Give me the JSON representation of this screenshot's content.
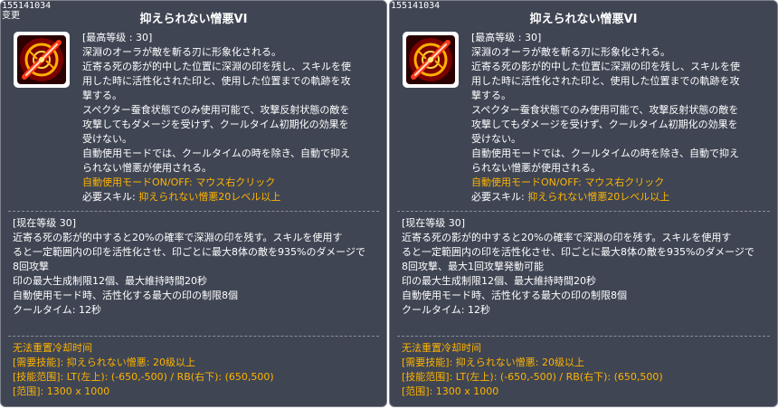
{
  "panels": [
    {
      "id_text": "155141034",
      "tag": "变更",
      "title": "抑えられない憎悪VI",
      "icon": "skill-icon",
      "desc": [
        "[最高等级 : 30]",
        "深淵のオーラが敵を斬る刃に形象化される。",
        "近寄る死の影が的中した位置に深淵の印を残し、スキルを使",
        "用した時に活性化された印と、使用した位置までの軌跡を攻",
        "撃する。",
        "スペクター蚕食状態でのみ使用可能で、攻撃反射状態の敵を",
        "攻撃してもダメージを受けず、クールタイム初期化の効果を",
        "受けない。",
        "自動使用モードでは、クールタイムの時を除き、自動で抑え",
        "られない憎悪が使用される。"
      ],
      "desc_orange": "自動使用モードON/OFF: マウス右クリック",
      "required_label": "必要スキル: ",
      "required_value": "抑えられない憎悪20レベル以上",
      "current": [
        "[现在等级 30]",
        "近寄る死の影が的中すると20%の確率で深淵の印を残す。スキルを使用す",
        "ると一定範囲内の印を活性化させ、印ごとに最大8体の敵を935%のダメージで",
        "8回攻撃",
        "印の最大生成制限12個、最大維持時間20秒",
        "自動使用モード時、活性化する最大の印の制限8個",
        "クールタイム: 12秒"
      ],
      "footer": [
        "无法重置冷却时间",
        "[需要技能]: 抑えられない憎悪: 20级以上",
        "[技能范围]: LT(左上): (-650,-500) / RB(右下): (650,500)",
        "[范围]: 1300 x 1000"
      ]
    },
    {
      "id_text": "155141034",
      "tag": "",
      "title": "抑えられない憎悪VI",
      "icon": "skill-icon",
      "desc": [
        "[最高等级 : 30]",
        "深淵のオーラが敵を斬る刃に形象化される。",
        "近寄る死の影が的中した位置に深淵の印を残し、スキルを使",
        "用した時に活性化された印と、使用した位置までの軌跡を攻",
        "撃する。",
        "スペクター蚕食状態でのみ使用可能で、攻撃反射状態の敵を",
        "攻撃してもダメージを受けず、クールタイム初期化の効果を",
        "受けない。",
        "自動使用モードでは、クールタイムの時を除き、自動で抑え",
        "られない憎悪が使用される。"
      ],
      "desc_orange": "自動使用モードON/OFF: マウス右クリック",
      "required_label": "必要スキル: ",
      "required_value": "抑えられない憎悪20レベル以上",
      "current": [
        "[现在等级 30]",
        "近寄る死の影が的中すると20%の確率で深淵の印を残す。スキルを使用す",
        "ると一定範囲内の印を活性化させ、印ごとに最大8体の敵を935%のダメージで",
        "8回攻撃、最大1回攻撃発動可能",
        "印の最大生成制限12個、最大維持時間20秒",
        "自動使用モード時、活性化する最大の印の制限8個",
        "クールタイム: 12秒"
      ],
      "footer": [
        "无法重置冷却时间",
        "[需要技能]: 抑えられない憎悪: 20级以上",
        "[技能范围]: LT(左上): (-650,-500) / RB(右下): (650,500)",
        "[范围]: 1300 x 1000"
      ]
    }
  ],
  "colors": {
    "panel_bg": "#3f4553",
    "highlight": "#ffb400",
    "text": "#ffffff"
  }
}
